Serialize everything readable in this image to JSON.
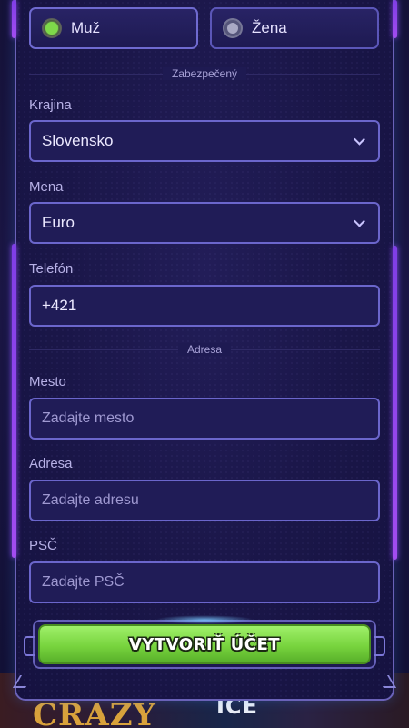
{
  "gender": {
    "options": [
      {
        "label": "Muž",
        "selected": true
      },
      {
        "label": "Žena",
        "selected": false
      }
    ]
  },
  "sections": {
    "secure": "Zabezpečený",
    "address": "Adresa"
  },
  "country": {
    "label": "Krajina",
    "value": "Slovensko"
  },
  "currency": {
    "label": "Mena",
    "value": "Euro"
  },
  "phone": {
    "label": "Telefón",
    "value": "+421"
  },
  "city": {
    "label": "Mesto",
    "placeholder": "Zadajte mesto"
  },
  "address": {
    "label": "Adresa",
    "placeholder": "Zadajte adresu"
  },
  "zip": {
    "label": "PSČ",
    "placeholder": "Zadajte PSČ"
  },
  "create_button": {
    "label": "VYTVORIŤ ÚČET"
  },
  "background": {
    "peek_left": "CRAZY",
    "peek_right": "ICE"
  },
  "colors": {
    "accent_green": "#78d43e",
    "panel_bg": "#1a1648",
    "field_border": "#6b66cc",
    "side_bar": "#8b46f0"
  }
}
